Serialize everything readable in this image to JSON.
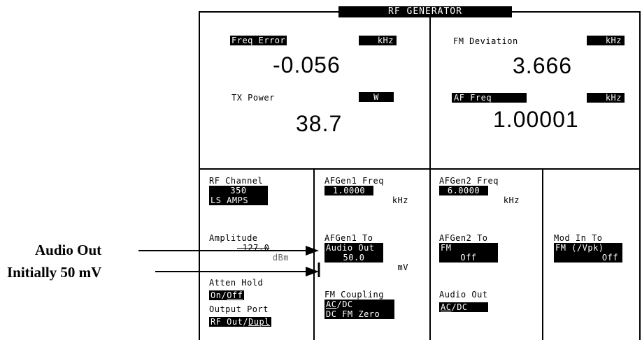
{
  "screen_title": "RF GENERATOR",
  "meters": {
    "freq_error": {
      "label": "Freq Error",
      "unit": "kHz",
      "value": "-0.056"
    },
    "tx_power": {
      "label": "TX Power",
      "unit": "W",
      "value": "38.7"
    },
    "fm_deviation": {
      "label": "FM Deviation",
      "unit": "kHz",
      "value": "3.666"
    },
    "af_freq": {
      "label": "AF Freq",
      "unit": "kHz",
      "value": "1.00001"
    }
  },
  "fields": {
    "rf_channel": {
      "label": "RF Channel",
      "value": "350",
      "sub": "LS AMPS"
    },
    "amplitude": {
      "label": "Amplitude",
      "value": "-127.0",
      "unit": "dBm"
    },
    "atten_hold": {
      "label": "Atten Hold",
      "on": "On",
      "sep": "/",
      "off": "Off"
    },
    "output_port": {
      "label": "Output Port",
      "a": "RF Out",
      "sep": "/",
      "b": "Dupl"
    },
    "afgen1_freq": {
      "label": "AFGen1 Freq",
      "value": "1.0000",
      "unit": "kHz"
    },
    "afgen1_to": {
      "label": "AFGen1 To",
      "dest": "Audio Out",
      "value": "50.0",
      "unit": "mV"
    },
    "fm_coupling": {
      "label": "FM Coupling",
      "ac": "AC",
      "sep": "/",
      "dc": "DC",
      "zero": "DC FM Zero"
    },
    "afgen2_freq": {
      "label": "AFGen2 Freq",
      "value": "6.0000",
      "unit": "kHz"
    },
    "afgen2_to": {
      "label": "AFGen2 To",
      "dest": "FM",
      "value": "Off"
    },
    "audio_out": {
      "label": "Audio Out",
      "ac": "AC",
      "sep": "/",
      "dc": "DC"
    },
    "mod_in_to": {
      "label": "Mod In To",
      "dest": "FM (/Vpk)",
      "value": "Off"
    }
  },
  "callouts": {
    "audio_out": "Audio Out",
    "initial": "Initially 50 mV"
  }
}
